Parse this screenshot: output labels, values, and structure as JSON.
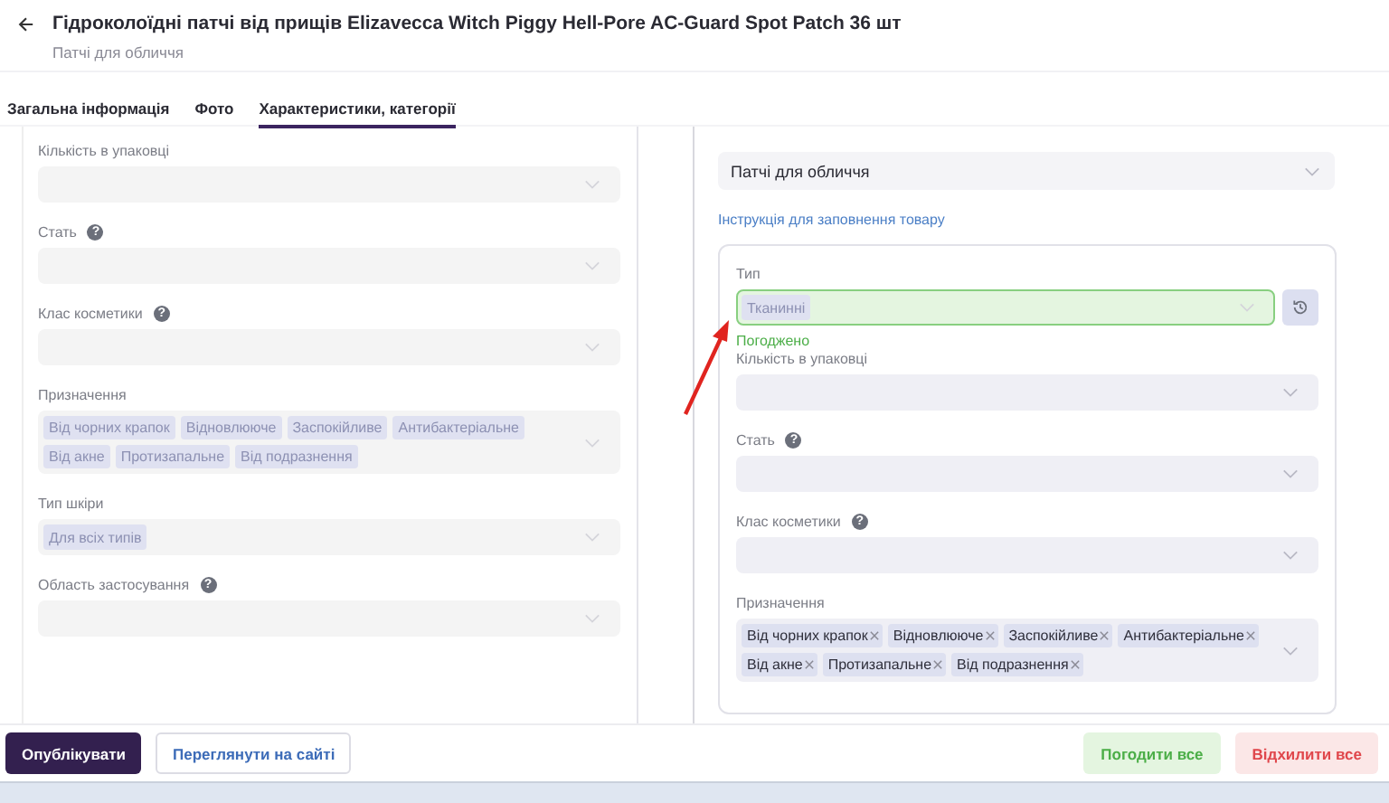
{
  "header": {
    "title": "Гідроколоїдні патчі від прищів Elizavecca Witch Piggy Hell-Pore AC-Guard Spot Patch 36 шт",
    "subtitle": "Патчі для обличчя"
  },
  "tabs": [
    {
      "label": "Загальна інформація",
      "selected": false
    },
    {
      "label": "Фото",
      "selected": false
    },
    {
      "label": "Характеристики, категорії",
      "selected": true
    }
  ],
  "left_panel": {
    "fields": [
      {
        "label": "Кількість в упаковці",
        "disabled": true
      },
      {
        "label": "Стать",
        "help": "?",
        "disabled": true
      },
      {
        "label": "Клас косметики",
        "help": "?",
        "disabled": true
      },
      {
        "label": "Призначення",
        "disabled": true,
        "chips": [
          "Від чорних крапок",
          "Відновлююче",
          "Заспокійливе",
          "Антибактеріальне",
          "Від акне",
          "Протизапальне",
          "Від подразнення"
        ]
      },
      {
        "label": "Тип шкіри",
        "disabled": true,
        "chips": [
          "Для всіх типів"
        ]
      },
      {
        "label": "Область застосування",
        "help": "?",
        "disabled": true
      }
    ]
  },
  "right_panel": {
    "category_value": "Патчі для обличчя",
    "instruction_link": "Інструкція для заповнення товару",
    "fields": [
      {
        "label": "Тип",
        "disabled": true,
        "approved": true,
        "status": "Погоджено",
        "chips": [
          "Тканинні"
        ]
      },
      {
        "label": "Кількість в упаковці",
        "disabled": false,
        "approved": false
      },
      {
        "label": "Стать",
        "help": "?",
        "disabled": false,
        "approved": false
      },
      {
        "label": "Клас косметики",
        "help": "?",
        "disabled": false,
        "approved": false
      },
      {
        "label": "Призначення",
        "disabled": false,
        "approved": false,
        "chips": [
          "Від чорних крапок",
          "Відновлююче",
          "Заспокійливе",
          "Антибактеріальне",
          "Від акне",
          "Протизапальне",
          "Від подразнення"
        ]
      }
    ]
  },
  "footer": {
    "publish": "Опублікувати",
    "view": "Переглянути на сайті",
    "approve_all": "Погодити все",
    "reject_all": "Відхилити все"
  }
}
